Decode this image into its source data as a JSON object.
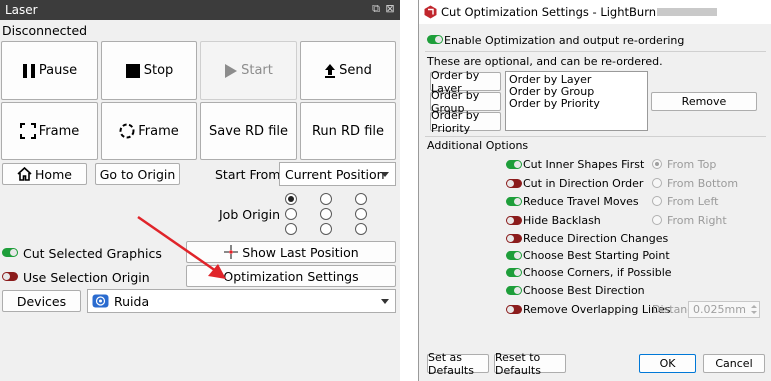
{
  "laser": {
    "title": "Laser",
    "status": "Disconnected",
    "buttons": {
      "pause": "Pause",
      "stop": "Stop",
      "start": "Start",
      "send": "Send",
      "frame1": "Frame",
      "frame2": "Frame",
      "save_rd": "Save RD file",
      "run_rd": "Run RD file",
      "home": "Home",
      "go_to_origin": "Go to Origin",
      "show_last_position": "Show Last Position",
      "optimization_settings": "Optimization Settings",
      "devices": "Devices"
    },
    "start_from_label": "Start From:",
    "start_from_value": "Current Position",
    "job_origin_label": "Job Origin",
    "cut_selected_graphics": "Cut Selected Graphics",
    "use_selection_origin": "Use Selection Origin",
    "device_value": "Ruida",
    "colors": {
      "accent_arrow": "#e0242a",
      "toggle_on": "#1e9e3a",
      "toggle_off": "#8b1c1c"
    }
  },
  "dialog": {
    "title": "Cut Optimization Settings - LightBurn",
    "enable_label": "Enable Optimization and output re-ordering",
    "optional_note": "These are optional, and can be re-ordered.",
    "order_buttons": [
      "Order by Layer",
      "Order by Group",
      "Order by Priority"
    ],
    "order_list": [
      "Order by Layer",
      "Order by Group",
      "Order by Priority"
    ],
    "remove_button": "Remove",
    "additional_options": "Additional Options",
    "options": [
      {
        "label": "Cut Inner Shapes First",
        "on": true
      },
      {
        "label": "Cut in Direction Order",
        "on": false
      },
      {
        "label": "Reduce Travel Moves",
        "on": true
      },
      {
        "label": "Hide Backlash",
        "on": false
      },
      {
        "label": "Reduce Direction Changes",
        "on": false
      },
      {
        "label": "Choose Best Starting Point",
        "on": true
      },
      {
        "label": "Choose Corners, if Possible",
        "on": true
      },
      {
        "label": "Choose Best Direction",
        "on": true
      },
      {
        "label": "Remove Overlapping Lines",
        "on": false
      }
    ],
    "direction_options": [
      "From Top",
      "From Bottom",
      "From Left",
      "From Right"
    ],
    "distance_label": "Distance:",
    "distance_value": "0.025mm",
    "set_as_defaults": "Set as Defaults",
    "reset_to_defaults": "Reset to Defaults",
    "ok": "OK",
    "cancel": "Cancel"
  }
}
